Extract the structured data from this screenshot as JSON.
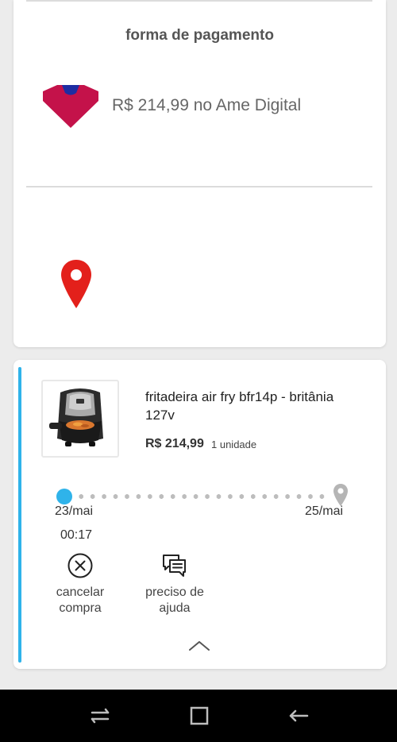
{
  "payment": {
    "title": "forma de pagamento",
    "amount_text": "R$ 214,99 no Ame Digital",
    "logo_icon": "ame-digital-logo",
    "logo_colors": [
      "#c4124a",
      "#1e2da2"
    ]
  },
  "address": {
    "icon": "location-pin-icon",
    "pin_color": "#e3201b"
  },
  "order": {
    "product_name": "fritadeira air fry bfr14p - britânia 127v",
    "price": "R$ 214,99",
    "quantity": "1 unidade",
    "accent_color": "#2fb3ea",
    "tracking": {
      "start_date": "23/mai",
      "start_time": "00:17",
      "end_date": "25/mai",
      "progress": 0
    },
    "actions": [
      {
        "label_line1": "cancelar",
        "label_line2": "compra",
        "icon": "cancel-circle-icon"
      },
      {
        "label_line1": "preciso de",
        "label_line2": "ajuda",
        "icon": "chat-bubbles-icon"
      }
    ],
    "collapse_icon": "chevron-up-icon"
  },
  "navbar": {
    "buttons": [
      "recent-apps-icon",
      "home-icon",
      "back-icon"
    ]
  }
}
